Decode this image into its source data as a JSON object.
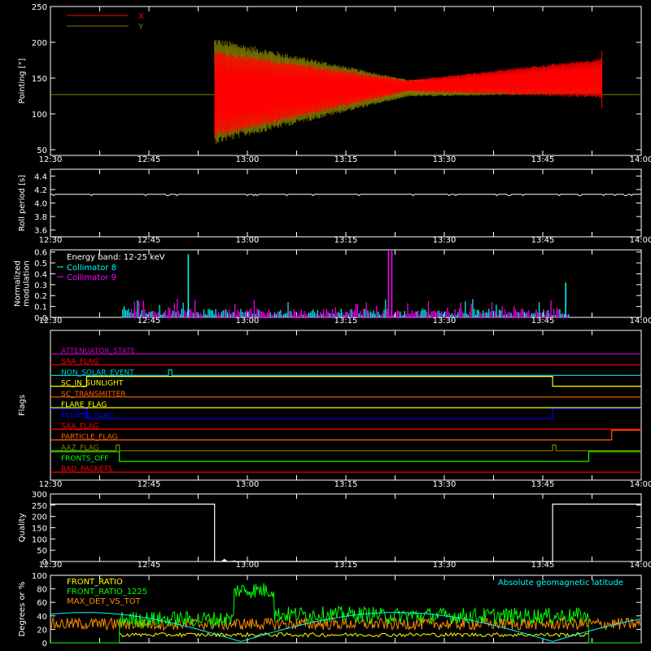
{
  "chart_data": [
    {
      "id": "pointing",
      "type": "line",
      "ylabel": "Pointing [\"]",
      "ylim": [
        42,
        250
      ],
      "yticks": [
        50,
        100,
        150,
        200,
        250
      ],
      "legend_position": "top-left",
      "series": [
        {
          "name": "X",
          "color": "#ff0000"
        },
        {
          "name": "Y",
          "color": "#808000"
        }
      ],
      "baseline_value": 127,
      "active_interval_min": [
        50,
        168
      ],
      "x_center": {
        "start": 128,
        "end": 150
      },
      "y_center": {
        "start": 132,
        "end": 140
      },
      "x_amplitude": {
        "start": 62,
        "middle": 8,
        "end": 28
      },
      "y_amplitude": {
        "start": 75,
        "middle": 12,
        "end": 12
      },
      "end_spike": {
        "max": 188,
        "min": 108
      }
    },
    {
      "id": "roll",
      "type": "line",
      "ylabel": "Roll period [s]",
      "ylim": [
        3.5,
        4.5
      ],
      "yticks": [
        3.6,
        3.8,
        4.0,
        4.2,
        4.4
      ],
      "series": [
        {
          "name": "",
          "color": "#ffffff",
          "value": 4.13
        }
      ]
    },
    {
      "id": "modulation",
      "type": "bar",
      "ylabel_lines": [
        "Normalized",
        "modulation"
      ],
      "ylim": [
        0,
        0.62
      ],
      "yticks": [
        0.0,
        0.1,
        0.2,
        0.3,
        0.4,
        0.5,
        0.6
      ],
      "legend_position": "top-left",
      "legend_title": "Energy band: 12-25 keV",
      "active_interval_min": [
        22,
        158
      ],
      "series": [
        {
          "name": "Collimator 8",
          "color": "#00ffff"
        },
        {
          "name": "Collimator 9",
          "color": "#ff00ff"
        }
      ],
      "spikes": [
        {
          "series": 0,
          "minute": 42,
          "value": 0.58
        },
        {
          "series": 1,
          "minute": 103,
          "value": 0.62
        },
        {
          "series": 1,
          "minute": 104,
          "value": 0.62
        },
        {
          "series": 0,
          "minute": 157,
          "value": 0.32
        }
      ]
    },
    {
      "id": "flags",
      "type": "line",
      "ylabel": "Flags",
      "flags": [
        {
          "name": "ATTENUATOR_STATE",
          "color": "#c000c0",
          "steps": []
        },
        {
          "name": "SAA_FLAG",
          "color": "#ff0000",
          "steps": []
        },
        {
          "name": "NON_SOLAR_EVENT",
          "color": "#00c8c8",
          "steps": [
            [
              36,
              37
            ]
          ]
        },
        {
          "name": "SC_IN_SUNLIGHT",
          "color": "#ffff00",
          "steps": [
            [
              0,
              11,
              "low"
            ],
            [
              11,
              153,
              "high"
            ],
            [
              153,
              180,
              "low"
            ]
          ]
        },
        {
          "name": "SC_TRANSMITTER",
          "color": "#ff6000",
          "steps": []
        },
        {
          "name": "FLARE_FLAG",
          "color": "#ffff00",
          "steps": []
        },
        {
          "name": "ECLIPSE_FLAG",
          "color": "#0000ff",
          "steps": [
            [
              0,
              11,
              "high"
            ],
            [
              11,
              153,
              "low"
            ],
            [
              153,
              180,
              "high"
            ]
          ]
        },
        {
          "name": "SAA_FLAG",
          "color": "#ff0000",
          "steps": []
        },
        {
          "name": "PARTICLE_FLAG",
          "color": "#ff6000",
          "steps": [
            [
              0,
              171,
              "low"
            ],
            [
              171,
              180,
              "high"
            ]
          ]
        },
        {
          "name": "AAZ_FLAG",
          "color": "#808000",
          "steps": [
            [
              20,
              21
            ],
            [
              153,
              154
            ]
          ]
        },
        {
          "name": "FRONTS_OFF",
          "color": "#00ff00",
          "steps": [
            [
              0,
              21,
              "high"
            ],
            [
              21,
              164,
              "low"
            ],
            [
              164,
              180,
              "high"
            ]
          ]
        },
        {
          "name": "BAD_PACKETS",
          "color": "#ff0000",
          "steps": []
        }
      ]
    },
    {
      "id": "quality",
      "type": "line",
      "ylabel": "Quality",
      "ylim": [
        0,
        300
      ],
      "yticks": [
        0,
        50,
        100,
        150,
        200,
        250,
        300
      ],
      "series": [
        {
          "name": "",
          "color": "#ffffff"
        }
      ],
      "segments": [
        {
          "from": 0,
          "to": 50,
          "value": 255
        },
        {
          "from": 50,
          "to": 153,
          "value": 0
        },
        {
          "from": 153,
          "to": 180,
          "value": 255
        }
      ],
      "bumps": [
        {
          "minute": 53,
          "value": 12
        },
        {
          "minute": 56,
          "value": 5
        }
      ]
    },
    {
      "id": "ratios",
      "type": "line",
      "ylabel": "Degrees or %",
      "ylim": [
        0,
        100
      ],
      "yticks": [
        0,
        20,
        40,
        60,
        80,
        100
      ],
      "annotation": "Absolute geomagnetic latitude",
      "annotation_color": "#00ffff",
      "series": [
        {
          "name": "FRONT_RATIO",
          "color": "#ffff00"
        },
        {
          "name": "FRONT_RATIO_1225",
          "color": "#00ff00"
        },
        {
          "name": "MAX_DET_VS_TOT",
          "color": "#ff8c00"
        }
      ],
      "latitude": {
        "color": "#00ffff",
        "max": 45,
        "min": 2,
        "period_min": 95
      },
      "front_ratio_1225_levels": [
        {
          "from": 21,
          "to": 56,
          "value": 35
        },
        {
          "from": 56,
          "to": 100,
          "value": 42
        },
        {
          "from": 100,
          "to": 164,
          "value": 40
        }
      ],
      "front_ratio_1225_high": {
        "from": 56,
        "to": 68,
        "value": 78
      },
      "max_det_level": 28,
      "front_ratio_level": 12
    }
  ],
  "time_axis": {
    "start_min": 0,
    "end_min": 180,
    "tick_minutes": [
      0,
      15,
      30,
      45,
      60,
      75,
      90,
      105,
      120,
      135,
      150,
      165
    ],
    "tick_labels": [
      "12:30",
      "12:45",
      "13:00",
      "13:15",
      "13:30",
      "13:45",
      "14:00"
    ]
  }
}
